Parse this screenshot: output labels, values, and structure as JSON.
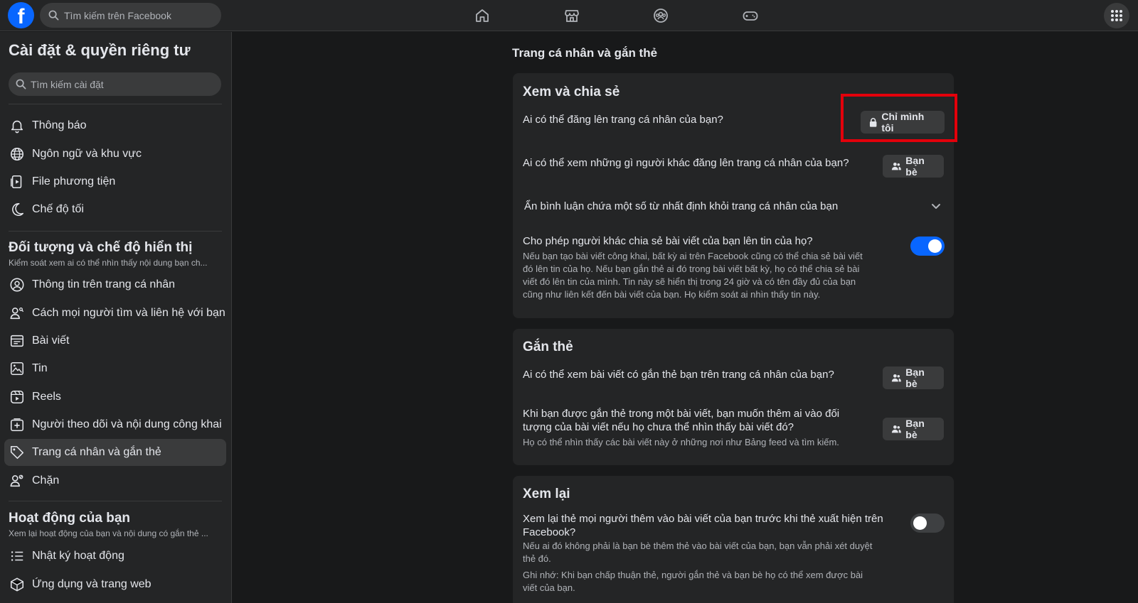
{
  "topbar": {
    "logo_letter": "f",
    "search_placeholder": "Tìm kiếm trên Facebook",
    "nav_icons": [
      "home-icon",
      "marketplace-icon",
      "groups-icon",
      "gaming-icon"
    ],
    "menu_icon": "grid-menu-icon"
  },
  "sidebar": {
    "title": "Cài đặt & quyền riêng tư",
    "search_placeholder": "Tìm kiếm cài đặt",
    "items_top": [
      {
        "label": "Thông báo",
        "icon": "bell-icon"
      },
      {
        "label": "Ngôn ngữ và khu vực",
        "icon": "globe-icon"
      },
      {
        "label": "File phương tiện",
        "icon": "media-icon"
      },
      {
        "label": "Chế độ tối",
        "icon": "moon-icon"
      }
    ],
    "section_audience": {
      "title": "Đối tượng và chế độ hiển thị",
      "subtitle": "Kiểm soát xem ai có thể nhìn thấy nội dung bạn ch..."
    },
    "items_audience": [
      {
        "label": "Thông tin trên trang cá nhân",
        "icon": "profile-icon"
      },
      {
        "label": "Cách mọi người tìm và liên hệ với bạn",
        "icon": "people-search-icon"
      },
      {
        "label": "Bài viết",
        "icon": "posts-icon"
      },
      {
        "label": "Tin",
        "icon": "stories-icon"
      },
      {
        "label": "Reels",
        "icon": "reels-icon"
      },
      {
        "label": "Người theo dõi và nội dung công khai",
        "icon": "followers-icon"
      },
      {
        "label": "Trang cá nhân và gắn thẻ",
        "icon": "tag-icon",
        "active": true
      },
      {
        "label": "Chặn",
        "icon": "block-user-icon"
      }
    ],
    "section_activity": {
      "title": "Hoạt động của bạn",
      "subtitle": "Xem lại hoạt động của bạn và nội dung có gắn thẻ ..."
    },
    "items_activity": [
      {
        "label": "Nhật ký hoạt động",
        "icon": "activity-log-icon"
      },
      {
        "label": "Ứng dụng và trang web",
        "icon": "apps-icon"
      }
    ]
  },
  "main": {
    "title": "Trang cá nhân và gắn thẻ",
    "view_share": {
      "title": "Xem và chia sẻ",
      "q1": "Ai có thể đăng lên trang cá nhân của bạn?",
      "q1_value": "Chỉ mình tôi",
      "q2": "Ai có thể xem những gì người khác đăng lên trang cá nhân của bạn?",
      "q2_value": "Bạn bè",
      "q3": "Ẩn bình luận chứa một số từ nhất định khỏi trang cá nhân của bạn",
      "q4": "Cho phép người khác chia sẻ bài viết của bạn lên tin của họ?",
      "q4_desc_l1": "Nếu bạn tạo bài viết công khai, bất kỳ ai trên Facebook cũng có thể chia sẻ bài viết",
      "q4_desc_l2": "đó lên tin của họ. Nếu bạn gắn thẻ ai đó trong bài viết bất kỳ, họ có thể chia sẻ bài",
      "q4_desc_l3": "viết đó lên tin của mình. Tin này sẽ hiển thị trong 24 giờ và có tên đầy đủ của bạn",
      "q4_desc_l4": "cũng như liên kết đến bài viết của bạn. Họ kiểm soát ai nhìn thấy tin này.",
      "q4_enabled": true
    },
    "tagging": {
      "title": "Gắn thẻ",
      "q1": "Ai có thể xem bài viết có gắn thẻ bạn trên trang cá nhân của bạn?",
      "q1_value": "Bạn bè",
      "q2_l1": "Khi bạn được gắn thẻ trong một bài viết, bạn muốn thêm ai vào đối",
      "q2_l2": "tượng của bài viết nếu họ chưa thể nhìn thấy bài viết đó?",
      "q2_desc": "Họ có thể nhìn thấy các bài viết này ở những nơi như Bảng feed và tìm kiếm.",
      "q2_value": "Bạn bè"
    },
    "review": {
      "title": "Xem lại",
      "q1_l1": "Xem lại thẻ mọi người thêm vào bài viết của bạn trước khi thẻ xuất hiện trên",
      "q1_l2": "Facebook?",
      "q1_desc_l1": "Nếu ai đó không phải là bạn bè thêm thẻ vào bài viết của bạn, bạn vẫn phải xét duyệt",
      "q1_desc_l2": "thẻ đó.",
      "q1_note_l1": "Ghi nhớ: Khi bạn chấp thuận thẻ, người gắn thẻ và bạn bè họ có thể xem được bài",
      "q1_note_l2": "viết của bạn.",
      "q1_enabled": false
    }
  },
  "colors": {
    "accent": "#0866ff",
    "highlight": "#e3000b"
  }
}
